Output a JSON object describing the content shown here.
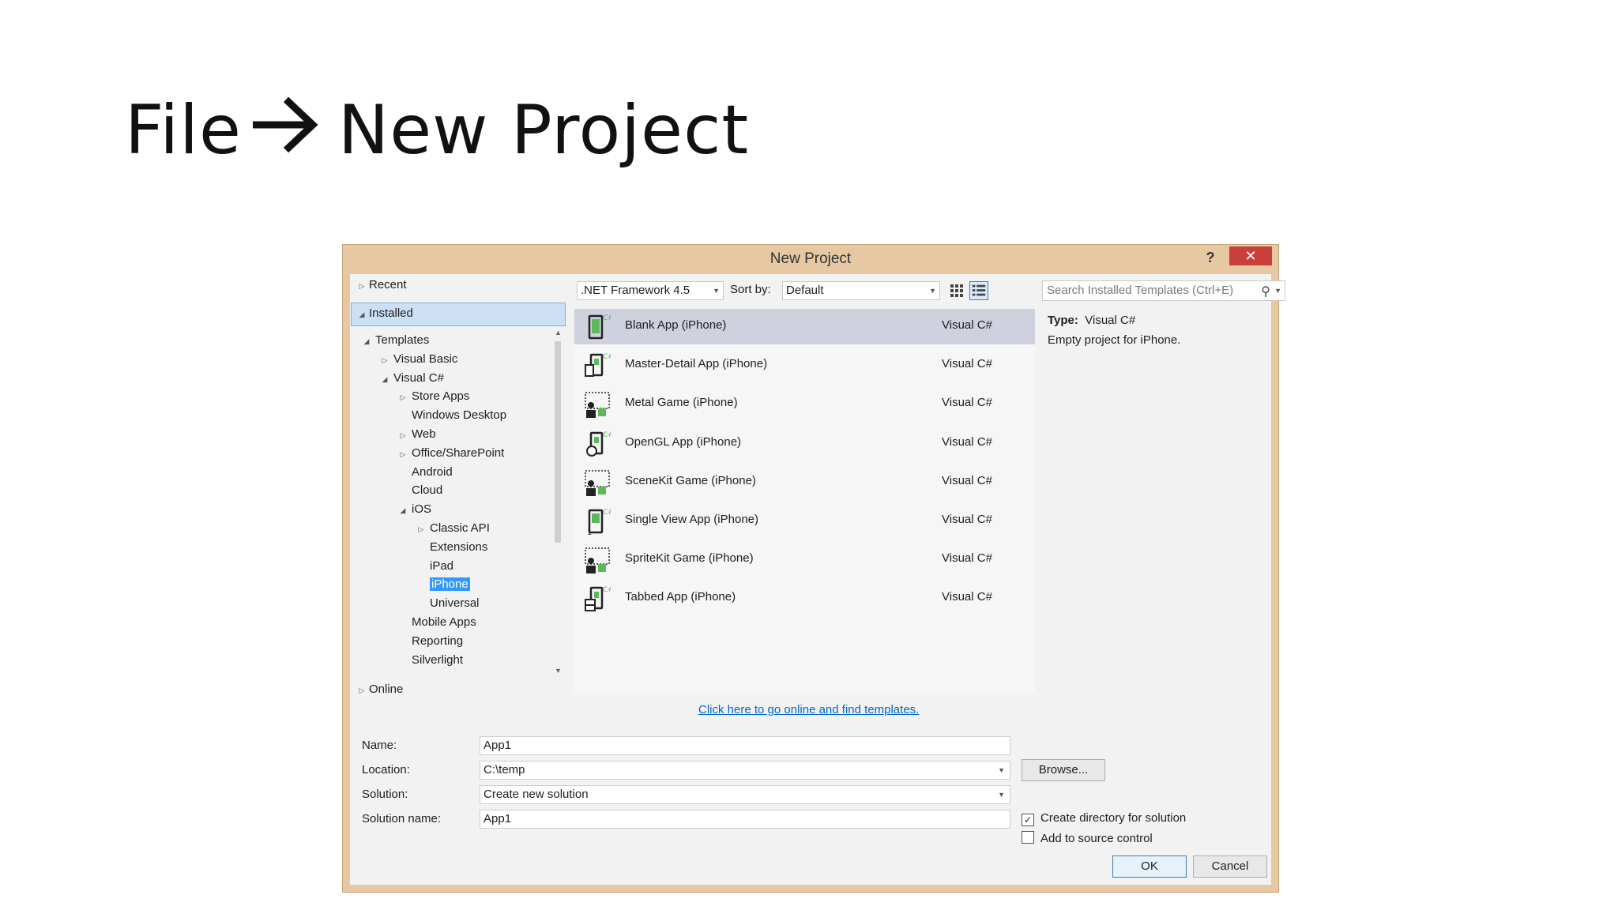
{
  "slide": {
    "title_left": "File",
    "title_right": "New Project"
  },
  "dialog": {
    "title": "New Project",
    "help": "?",
    "close": "✕"
  },
  "tree": {
    "recent": "Recent",
    "installed": "Installed",
    "online": "Online",
    "items": [
      {
        "label": "Templates",
        "level": 0,
        "expander": "open"
      },
      {
        "label": "Visual Basic",
        "level": 1,
        "expander": "closed"
      },
      {
        "label": "Visual C#",
        "level": 1,
        "expander": "open"
      },
      {
        "label": "Store Apps",
        "level": 2,
        "expander": "closed"
      },
      {
        "label": "Windows Desktop",
        "level": 2,
        "expander": "none"
      },
      {
        "label": "Web",
        "level": 2,
        "expander": "closed"
      },
      {
        "label": "Office/SharePoint",
        "level": 2,
        "expander": "closed"
      },
      {
        "label": "Android",
        "level": 2,
        "expander": "none"
      },
      {
        "label": "Cloud",
        "level": 2,
        "expander": "none"
      },
      {
        "label": "iOS",
        "level": 2,
        "expander": "open"
      },
      {
        "label": "Classic API",
        "level": 3,
        "expander": "closed"
      },
      {
        "label": "Extensions",
        "level": 3,
        "expander": "none"
      },
      {
        "label": "iPad",
        "level": 3,
        "expander": "none"
      },
      {
        "label": "iPhone",
        "level": 3,
        "expander": "none",
        "selected": true
      },
      {
        "label": "Universal",
        "level": 3,
        "expander": "none"
      },
      {
        "label": "Mobile Apps",
        "level": 2,
        "expander": "none"
      },
      {
        "label": "Reporting",
        "level": 2,
        "expander": "none"
      },
      {
        "label": "Silverlight",
        "level": 2,
        "expander": "none"
      }
    ]
  },
  "toolbar": {
    "framework": ".NET Framework 4.5",
    "sort_label": "Sort by:",
    "sort_value": "Default"
  },
  "search": {
    "placeholder": "Search Installed Templates (Ctrl+E)"
  },
  "templates": [
    {
      "name": "Blank App (iPhone)",
      "lang": "Visual C#",
      "icon": "blank-app-icon",
      "selected": true
    },
    {
      "name": "Master-Detail App (iPhone)",
      "lang": "Visual C#",
      "icon": "master-detail-app-icon"
    },
    {
      "name": "Metal Game (iPhone)",
      "lang": "Visual C#",
      "icon": "metal-game-icon"
    },
    {
      "name": "OpenGL App (iPhone)",
      "lang": "Visual C#",
      "icon": "opengl-app-icon"
    },
    {
      "name": "SceneKit Game (iPhone)",
      "lang": "Visual C#",
      "icon": "scenekit-game-icon"
    },
    {
      "name": "Single View App (iPhone)",
      "lang": "Visual C#",
      "icon": "single-view-app-icon"
    },
    {
      "name": "SpriteKit Game (iPhone)",
      "lang": "Visual C#",
      "icon": "spritekit-game-icon"
    },
    {
      "name": "Tabbed App (iPhone)",
      "lang": "Visual C#",
      "icon": "tabbed-app-icon"
    }
  ],
  "details": {
    "type_label": "Type:",
    "type_value": "Visual C#",
    "description": "Empty project for iPhone."
  },
  "online_link": "Click here to go online and find templates.",
  "form": {
    "name_label": "Name:",
    "name_value": "App1",
    "location_label": "Location:",
    "location_value": "C:\\temp",
    "solution_label": "Solution:",
    "solution_value": "Create new solution",
    "solution_name_label": "Solution name:",
    "solution_name_value": "App1",
    "browse": "Browse...",
    "create_dir": "Create directory for solution",
    "create_dir_checked": true,
    "source_control": "Add to source control",
    "source_control_checked": false,
    "ok": "OK",
    "cancel": "Cancel"
  },
  "colors": {
    "dialog_frame": "#e6c9a3",
    "close_button": "#c9403a",
    "selection": "#3399ff",
    "installed_highlight": "#cbe0f5",
    "link": "#0066cc"
  }
}
